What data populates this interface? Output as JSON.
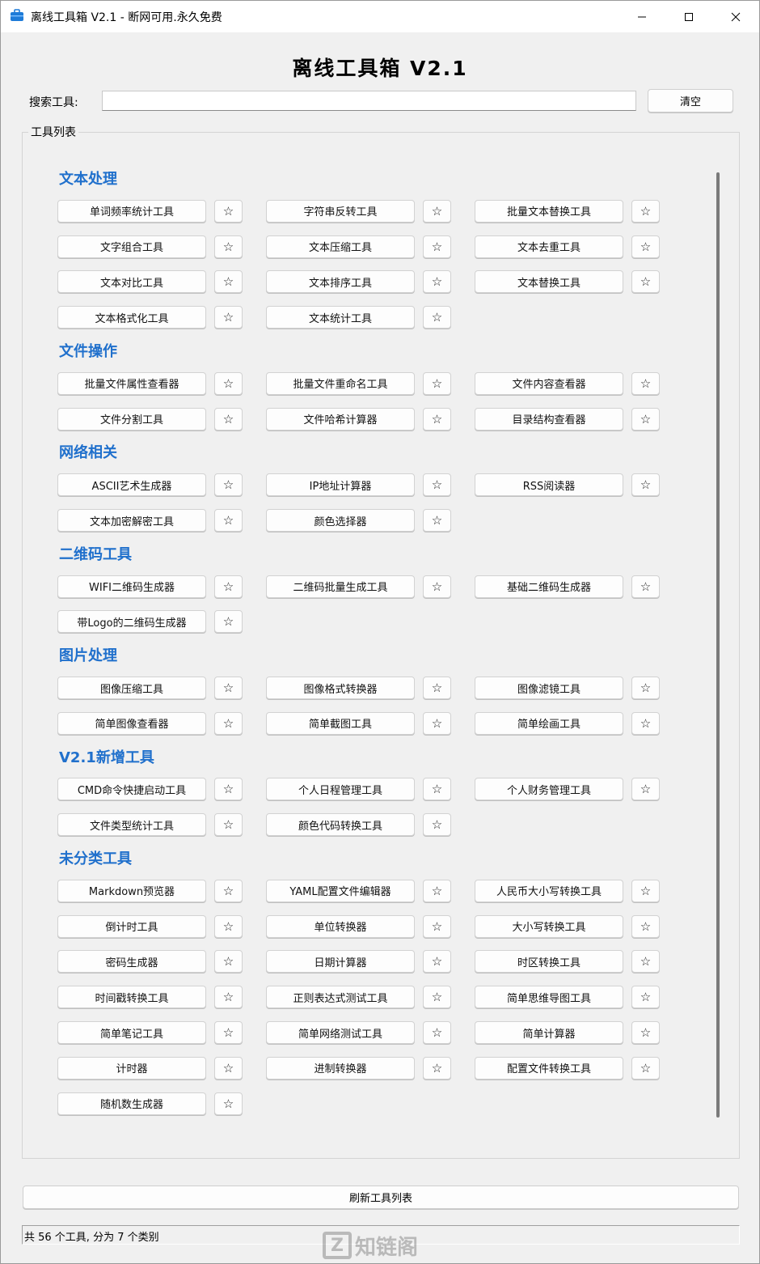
{
  "window": {
    "title": "离线工具箱 V2.1 - 断网可用.永久免费",
    "app_icon": "toolbox-icon",
    "controls": {
      "minimize": "—",
      "maximize": "☐",
      "close": "✕"
    }
  },
  "header": {
    "title": "离线工具箱 V2.1"
  },
  "search": {
    "label": "搜索工具:",
    "value": "",
    "placeholder": "",
    "clear_label": "清空"
  },
  "tool_list": {
    "legend": "工具列表",
    "star_glyph": "☆",
    "categories": [
      {
        "name": "文本处理",
        "tools": [
          "单词频率统计工具",
          "字符串反转工具",
          "批量文本替换工具",
          "文字组合工具",
          "文本压缩工具",
          "文本去重工具",
          "文本对比工具",
          "文本排序工具",
          "文本替换工具",
          "文本格式化工具",
          "文本统计工具"
        ]
      },
      {
        "name": "文件操作",
        "tools": [
          "批量文件属性查看器",
          "批量文件重命名工具",
          "文件内容查看器",
          "文件分割工具",
          "文件哈希计算器",
          "目录结构查看器"
        ]
      },
      {
        "name": "网络相关",
        "tools": [
          "ASCII艺术生成器",
          "IP地址计算器",
          "RSS阅读器",
          "文本加密解密工具",
          "颜色选择器"
        ]
      },
      {
        "name": "二维码工具",
        "tools": [
          "WIFI二维码生成器",
          "二维码批量生成工具",
          "基础二维码生成器",
          "带Logo的二维码生成器"
        ]
      },
      {
        "name": "图片处理",
        "tools": [
          "图像压缩工具",
          "图像格式转换器",
          "图像滤镜工具",
          "简单图像查看器",
          "简单截图工具",
          "简单绘画工具"
        ]
      },
      {
        "name": "V2.1新增工具",
        "tools": [
          "CMD命令快捷启动工具",
          "个人日程管理工具",
          "个人财务管理工具",
          "文件类型统计工具",
          "颜色代码转换工具"
        ]
      },
      {
        "name": "未分类工具",
        "tools": [
          "Markdown预览器",
          "YAML配置文件编辑器",
          "人民币大小写转换工具",
          "倒计时工具",
          "单位转换器",
          "大小写转换工具",
          "密码生成器",
          "日期计算器",
          "时区转换工具",
          "时间戳转换工具",
          "正则表达式测试工具",
          "简单思维导图工具",
          "简单笔记工具",
          "简单网络测试工具",
          "简单计算器",
          "计时器",
          "进制转换器",
          "配置文件转换工具",
          "随机数生成器"
        ]
      }
    ]
  },
  "footer": {
    "refresh_label": "刷新工具列表",
    "status_text": "共 56 个工具, 分为 7 个类别"
  },
  "watermark": {
    "text": "知链阁"
  },
  "colors": {
    "category_title": "#2070cc",
    "background": "#f0f0f0"
  }
}
